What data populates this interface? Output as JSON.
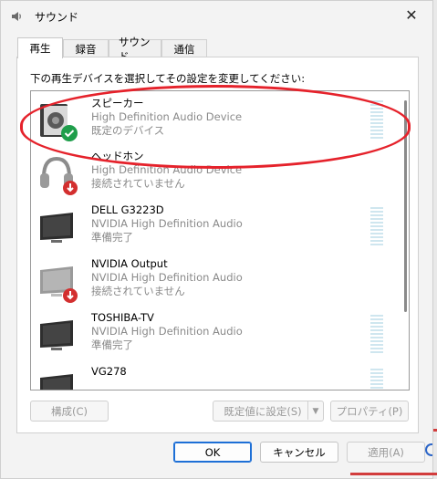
{
  "window": {
    "title": "サウンド",
    "close_label": "✕"
  },
  "tabs": [
    {
      "label": "再生",
      "active": true
    },
    {
      "label": "録音",
      "active": false
    },
    {
      "label": "サウンド",
      "active": false
    },
    {
      "label": "通信",
      "active": false
    }
  ],
  "instruction": "下の再生デバイスを選択してその設定を変更してください:",
  "devices": [
    {
      "name": "スピーカー",
      "sub": "High Definition Audio Device",
      "status": "既定のデバイス",
      "icon": "speaker-icon",
      "badge": "check-badge-icon"
    },
    {
      "name": "ヘッドホン",
      "sub": "High Definition Audio Device",
      "status": "接続されていません",
      "icon": "headphones-icon",
      "badge": "disconnected-badge-icon"
    },
    {
      "name": "DELL G3223D",
      "sub": "NVIDIA High Definition Audio",
      "status": "準備完了",
      "icon": "monitor-icon",
      "badge": ""
    },
    {
      "name": "NVIDIA Output",
      "sub": "NVIDIA High Definition Audio",
      "status": "接続されていません",
      "icon": "monitor-icon",
      "badge": "disconnected-badge-icon"
    },
    {
      "name": "TOSHIBA-TV",
      "sub": "NVIDIA High Definition Audio",
      "status": "準備完了",
      "icon": "monitor-icon",
      "badge": ""
    },
    {
      "name": "VG278",
      "sub": "",
      "status": "",
      "icon": "monitor-icon",
      "badge": ""
    }
  ],
  "buttons": {
    "configure": "構成(C)",
    "set_default": "既定値に設定(S)",
    "properties": "プロパティ(P)",
    "ok": "OK",
    "cancel": "キャンセル",
    "apply": "適用(A)"
  },
  "colors": {
    "highlight": "#e5222b",
    "check": "#1f9e4b",
    "disconnected": "#d32f2f",
    "accent": "#1d6fd6"
  }
}
